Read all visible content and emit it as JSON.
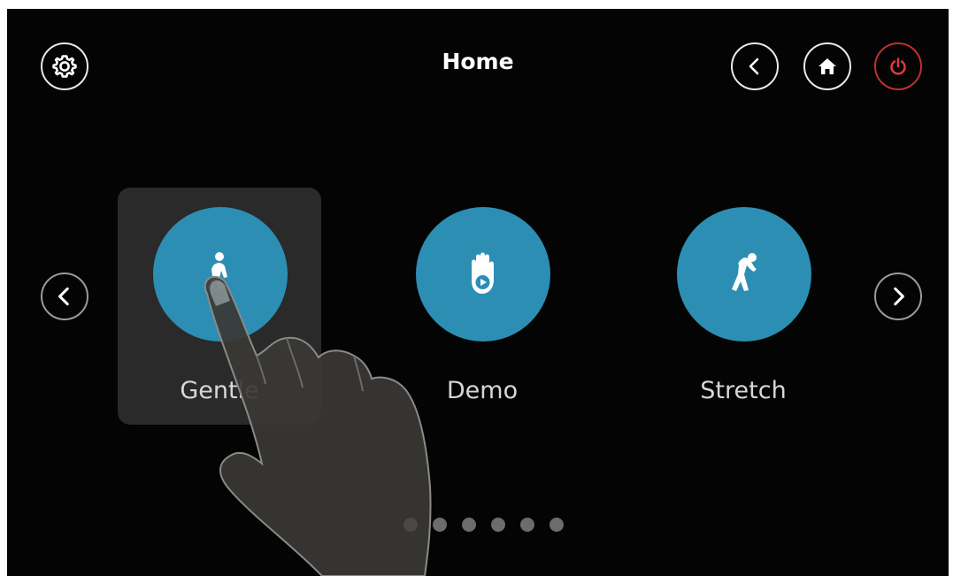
{
  "header": {
    "title": "Home",
    "icons": {
      "settings": "gear-icon",
      "back": "chevron-left-icon",
      "home": "home-icon",
      "power": "power-icon"
    },
    "power_color": "#e0393d"
  },
  "carousel": {
    "items": [
      {
        "label": "Gentle",
        "icon": "walking-person-icon",
        "selected": true
      },
      {
        "label": "Demo",
        "icon": "hand-play-icon",
        "selected": false
      },
      {
        "label": "Stretch",
        "icon": "stretching-person-icon",
        "selected": false
      }
    ],
    "prev_icon": "chevron-left-icon",
    "next_icon": "chevron-right-icon",
    "page_count": 6,
    "current_page": 1
  },
  "colors": {
    "accent": "#2d8eb4",
    "background": "#040404"
  }
}
